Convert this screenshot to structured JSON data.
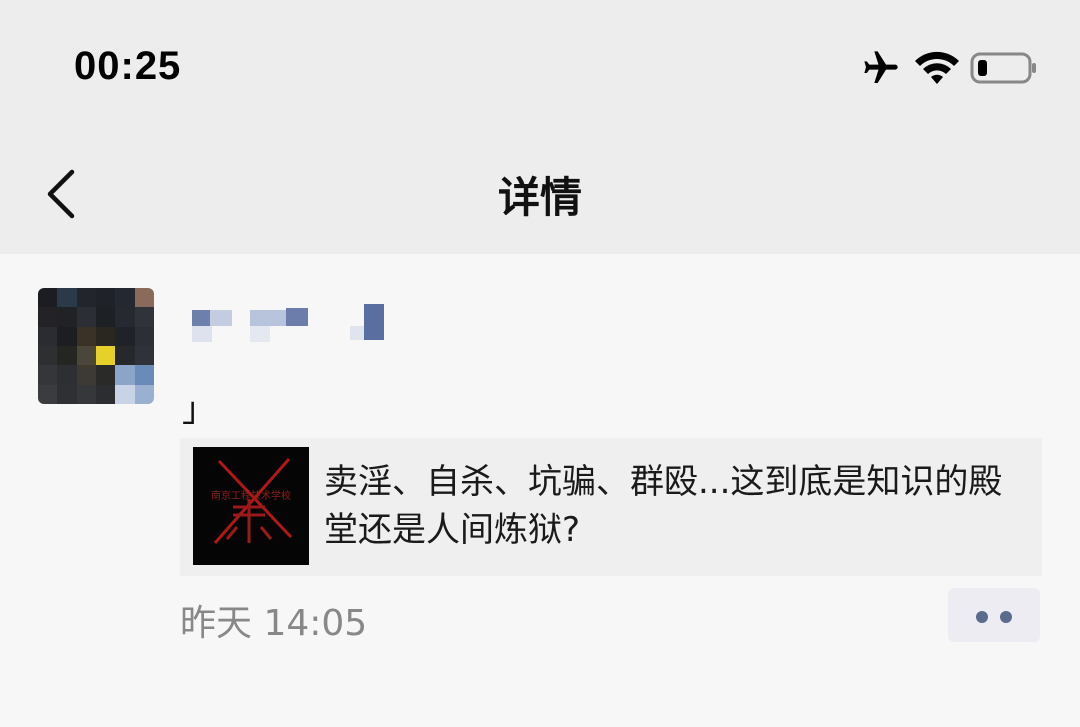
{
  "status_bar": {
    "time": "00:25",
    "icons": [
      "airplane-icon",
      "wifi-icon",
      "battery-icon"
    ]
  },
  "nav": {
    "title": "详情",
    "back_icon": "chevron-left-icon"
  },
  "post": {
    "text": "」",
    "share": {
      "thumbnail_text": "南京工程技术学校",
      "title": "卖淫、自杀、坑骗、群殴...这到底是知识的殿堂还是人间炼狱?"
    },
    "time": "昨天 14:05",
    "more_icon": "more-dots-icon"
  },
  "colors": {
    "background": "#f7f7f7",
    "bar": "#ededed",
    "card": "#efefef",
    "link_dots": "#5a6b8e"
  }
}
